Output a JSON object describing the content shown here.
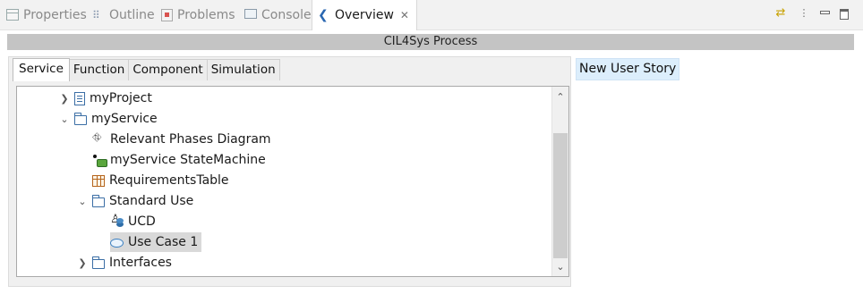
{
  "view_tabs": [
    {
      "label": "Properties",
      "icon": "properties-icon"
    },
    {
      "label": "Outline",
      "icon": "outline-icon"
    },
    {
      "label": "Problems",
      "icon": "problems-icon"
    },
    {
      "label": "Console",
      "icon": "console-icon"
    },
    {
      "label": "Overview",
      "icon": "overview-icon",
      "active": true,
      "closable": true
    }
  ],
  "toolbar": {
    "icons": [
      "sync-icon",
      "view-menu-icon",
      "minimize-icon",
      "maximize-icon"
    ]
  },
  "process_title": "CIL4Sys Process",
  "section_tabs": [
    {
      "label": "Service",
      "active": true
    },
    {
      "label": "Function"
    },
    {
      "label": "Component"
    },
    {
      "label": "Simulation"
    }
  ],
  "tree": [
    {
      "label": "myProject",
      "icon": "project-icon",
      "expander": "collapsed"
    },
    {
      "label": "myService",
      "icon": "folder-icon",
      "expander": "expanded"
    },
    {
      "label": "Relevant Phases Diagram",
      "icon": "diagram-icon"
    },
    {
      "label": "myService StateMachine",
      "icon": "state-machine-icon"
    },
    {
      "label": "RequirementsTable",
      "icon": "table-icon"
    },
    {
      "label": "Standard Use",
      "icon": "folder-icon",
      "expander": "expanded"
    },
    {
      "label": "UCD",
      "icon": "use-case-diagram-icon"
    },
    {
      "label": "Use Case 1",
      "icon": "use-case-icon",
      "selected": true
    },
    {
      "label": "Interfaces",
      "icon": "folder-icon",
      "expander": "collapsed"
    }
  ],
  "user_story_button": "New User Story"
}
